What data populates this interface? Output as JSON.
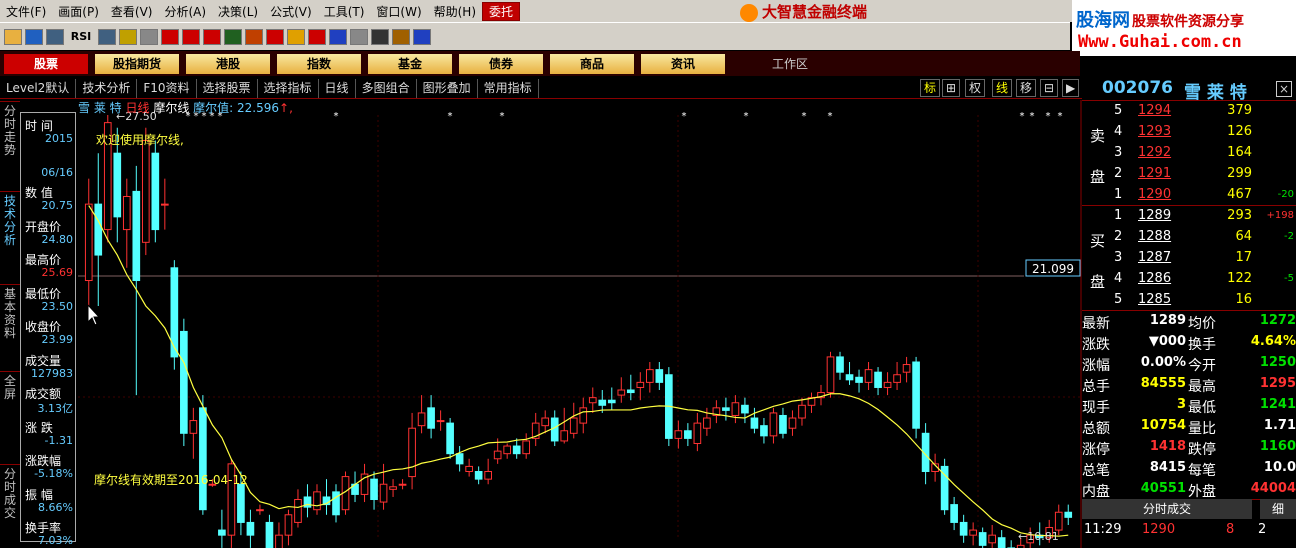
{
  "menu": [
    "文件(F)",
    "画面(P)",
    "查看(V)",
    "分析(A)",
    "决策(L)",
    "公式(V)",
    "工具(T)",
    "窗口(W)",
    "帮助(H)",
    "委托"
  ],
  "brand": "大智慧金融终端",
  "guhai": {
    "name": "股海网",
    "slogan": "股票软件资源分享",
    "url": "Www.Guhai.com.cn"
  },
  "toolbar_icons": [
    "folder-icon",
    "chart-icon",
    "grid-icon",
    "rsi-icon",
    "table-icon",
    "crosshair-icon",
    "ruler-icon",
    "dollar-icon",
    "eye-icon",
    "bars-icon",
    "binoculars-icon",
    "speaker-icon",
    "pin-icon",
    "diamond-icon",
    "bullseye-icon",
    "globe-icon",
    "doc-icon",
    "window-icon",
    "books-icon",
    "help-icon"
  ],
  "toolbar_rsi": "RSI",
  "nav": [
    "股票",
    "股指期货",
    "港股",
    "指数",
    "基金",
    "债券",
    "商品",
    "资讯"
  ],
  "workspace": "工作区",
  "tabs": [
    "Level2默认",
    "技术分析",
    "F10资料",
    "选择股票",
    "选择指标",
    "日线",
    "多图组合",
    "图形叠加",
    "常用指标"
  ],
  "tab_right": [
    "标",
    "权",
    "线",
    "移"
  ],
  "left_vertical": [
    "分时走势",
    "技术分析",
    "基本资料",
    "全屏",
    "分时成交"
  ],
  "chart_header": {
    "name": "雪 莱 特",
    "period": "日线",
    "indicator": "摩尔线",
    "ind_value": "摩尔值: 22.596",
    "high_label": "27.50",
    "low_label": "10.81",
    "welcome": "欢迎使用摩尔线,",
    "expiry": "摩尔线有效期至2016-04-12",
    "cursor_price": "21.099"
  },
  "info": [
    {
      "label": "时 间",
      "val": "2015"
    },
    {
      "label": "",
      "val": "06/16"
    },
    {
      "label": "数 值",
      "val": "20.75"
    },
    {
      "label": "开盘价",
      "val": "24.80"
    },
    {
      "label": "最高价",
      "val": "25.69"
    },
    {
      "label": "最低价",
      "val": "23.50"
    },
    {
      "label": "收盘价",
      "val": "23.99"
    },
    {
      "label": "成交量",
      "val": "127983"
    },
    {
      "label": "成交额",
      "val": "3.13亿"
    },
    {
      "label": "涨 跌",
      "val": "-1.31"
    },
    {
      "label": "涨跌幅",
      "val": "-5.18%"
    },
    {
      "label": "振 幅",
      "val": "8.66%"
    },
    {
      "label": "换手率",
      "val": "7.03%"
    }
  ],
  "stock": {
    "code": "002076",
    "name": "雪 莱 特"
  },
  "sell": [
    {
      "n": "5",
      "p": "1294",
      "v": "379",
      "c": ""
    },
    {
      "n": "4",
      "p": "1293",
      "v": "126",
      "c": ""
    },
    {
      "n": "3",
      "p": "1292",
      "v": "164",
      "c": ""
    },
    {
      "n": "2",
      "p": "1291",
      "v": "299",
      "c": ""
    },
    {
      "n": "1",
      "p": "1290",
      "v": "467",
      "c": "-20"
    }
  ],
  "buy": [
    {
      "n": "1",
      "p": "1289",
      "v": "293",
      "c": "+198"
    },
    {
      "n": "2",
      "p": "1288",
      "v": "64",
      "c": "-2"
    },
    {
      "n": "3",
      "p": "1287",
      "v": "17",
      "c": ""
    },
    {
      "n": "4",
      "p": "1286",
      "v": "122",
      "c": "-5"
    },
    {
      "n": "5",
      "p": "1285",
      "v": "16",
      "c": ""
    }
  ],
  "sell_label": [
    "卖",
    "盘"
  ],
  "buy_label": [
    "买",
    "盘"
  ],
  "quote": [
    [
      "最新",
      "1289",
      "均价",
      "1272"
    ],
    [
      "涨跌",
      "▼000",
      "换手",
      "4.64%"
    ],
    [
      "涨幅",
      "0.00%",
      "今开",
      "1250"
    ],
    [
      "总手",
      "84555",
      "最高",
      "1295"
    ],
    [
      "现手",
      "3",
      "最低",
      "1241"
    ],
    [
      "总额",
      "10754",
      "量比",
      "1.71"
    ],
    [
      "涨停",
      "1418",
      "跌停",
      "1160"
    ],
    [
      "总笔",
      "8415",
      "每笔",
      "10.0"
    ],
    [
      "内盘",
      "40551",
      "外盘",
      "44004"
    ]
  ],
  "ticks_title": "分时成交",
  "ticks_btn": "细",
  "tick_row": {
    "time": "11:29",
    "price": "1290",
    "vol": "8",
    "n": "2"
  },
  "colors": {
    "up": "#ff3232",
    "down": "#54ffff",
    "ma": "#ffff40"
  },
  "chart_data": {
    "type": "candlestick",
    "high": "27.50",
    "low": "10.81",
    "ma_values": "yellow moving line"
  }
}
